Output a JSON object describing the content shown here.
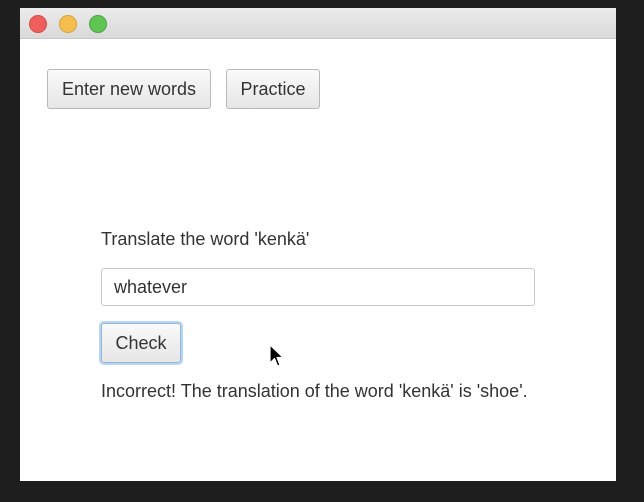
{
  "buttons": {
    "enter_new_words": "Enter new words",
    "practice": "Practice",
    "check": "Check"
  },
  "practice_view": {
    "prompt": "Translate the word 'kenkä'",
    "answer_value": "whatever",
    "result": "Incorrect! The translation of the word 'kenkä' is 'shoe'."
  }
}
